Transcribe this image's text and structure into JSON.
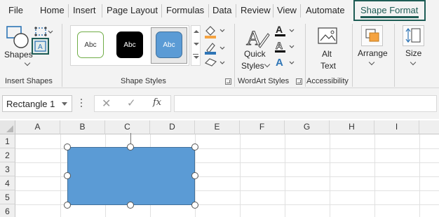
{
  "tabs": {
    "file": "File",
    "home": "Home",
    "insert": "Insert",
    "page_layout": "Page Layout",
    "formulas": "Formulas",
    "data": "Data",
    "review": "Review",
    "view": "View",
    "automate": "Automate",
    "shape_format": "Shape Format"
  },
  "ribbon": {
    "insert_shapes": {
      "label": "Insert Shapes",
      "shapes_button": "Shapes"
    },
    "shape_styles": {
      "label": "Shape Styles",
      "swatches": [
        "Abc",
        "Abc",
        "Abc"
      ],
      "selected_index": 2
    },
    "wordart_styles": {
      "label": "WordArt Styles",
      "quick_styles_line1": "Quick",
      "quick_styles_line2": "Styles"
    },
    "accessibility": {
      "label": "Accessibility",
      "alt_text_line1": "Alt",
      "alt_text_line2": "Text"
    },
    "arrange": {
      "label": "Arrange"
    },
    "size": {
      "label": "Size"
    }
  },
  "formula_bar": {
    "name_box": "Rectangle 1",
    "cancel_symbol": "✕",
    "enter_symbol": "✓",
    "function_symbol": "fx",
    "formula": ""
  },
  "sheet": {
    "columns": [
      "A",
      "B",
      "C",
      "D",
      "E",
      "F",
      "G",
      "H",
      "I"
    ],
    "rows": [
      "1",
      "2",
      "3",
      "4",
      "5",
      "6"
    ]
  },
  "selected_shape": {
    "fill": "#5b9bd5",
    "outline": "#41719c"
  },
  "colors": {
    "accent": "#1e5c55",
    "ribbon_bg": "#f3f3f3",
    "fill_icon": "#f5a340",
    "line_icon": "#2e75b6",
    "wordart_a": "#2e75b6"
  }
}
